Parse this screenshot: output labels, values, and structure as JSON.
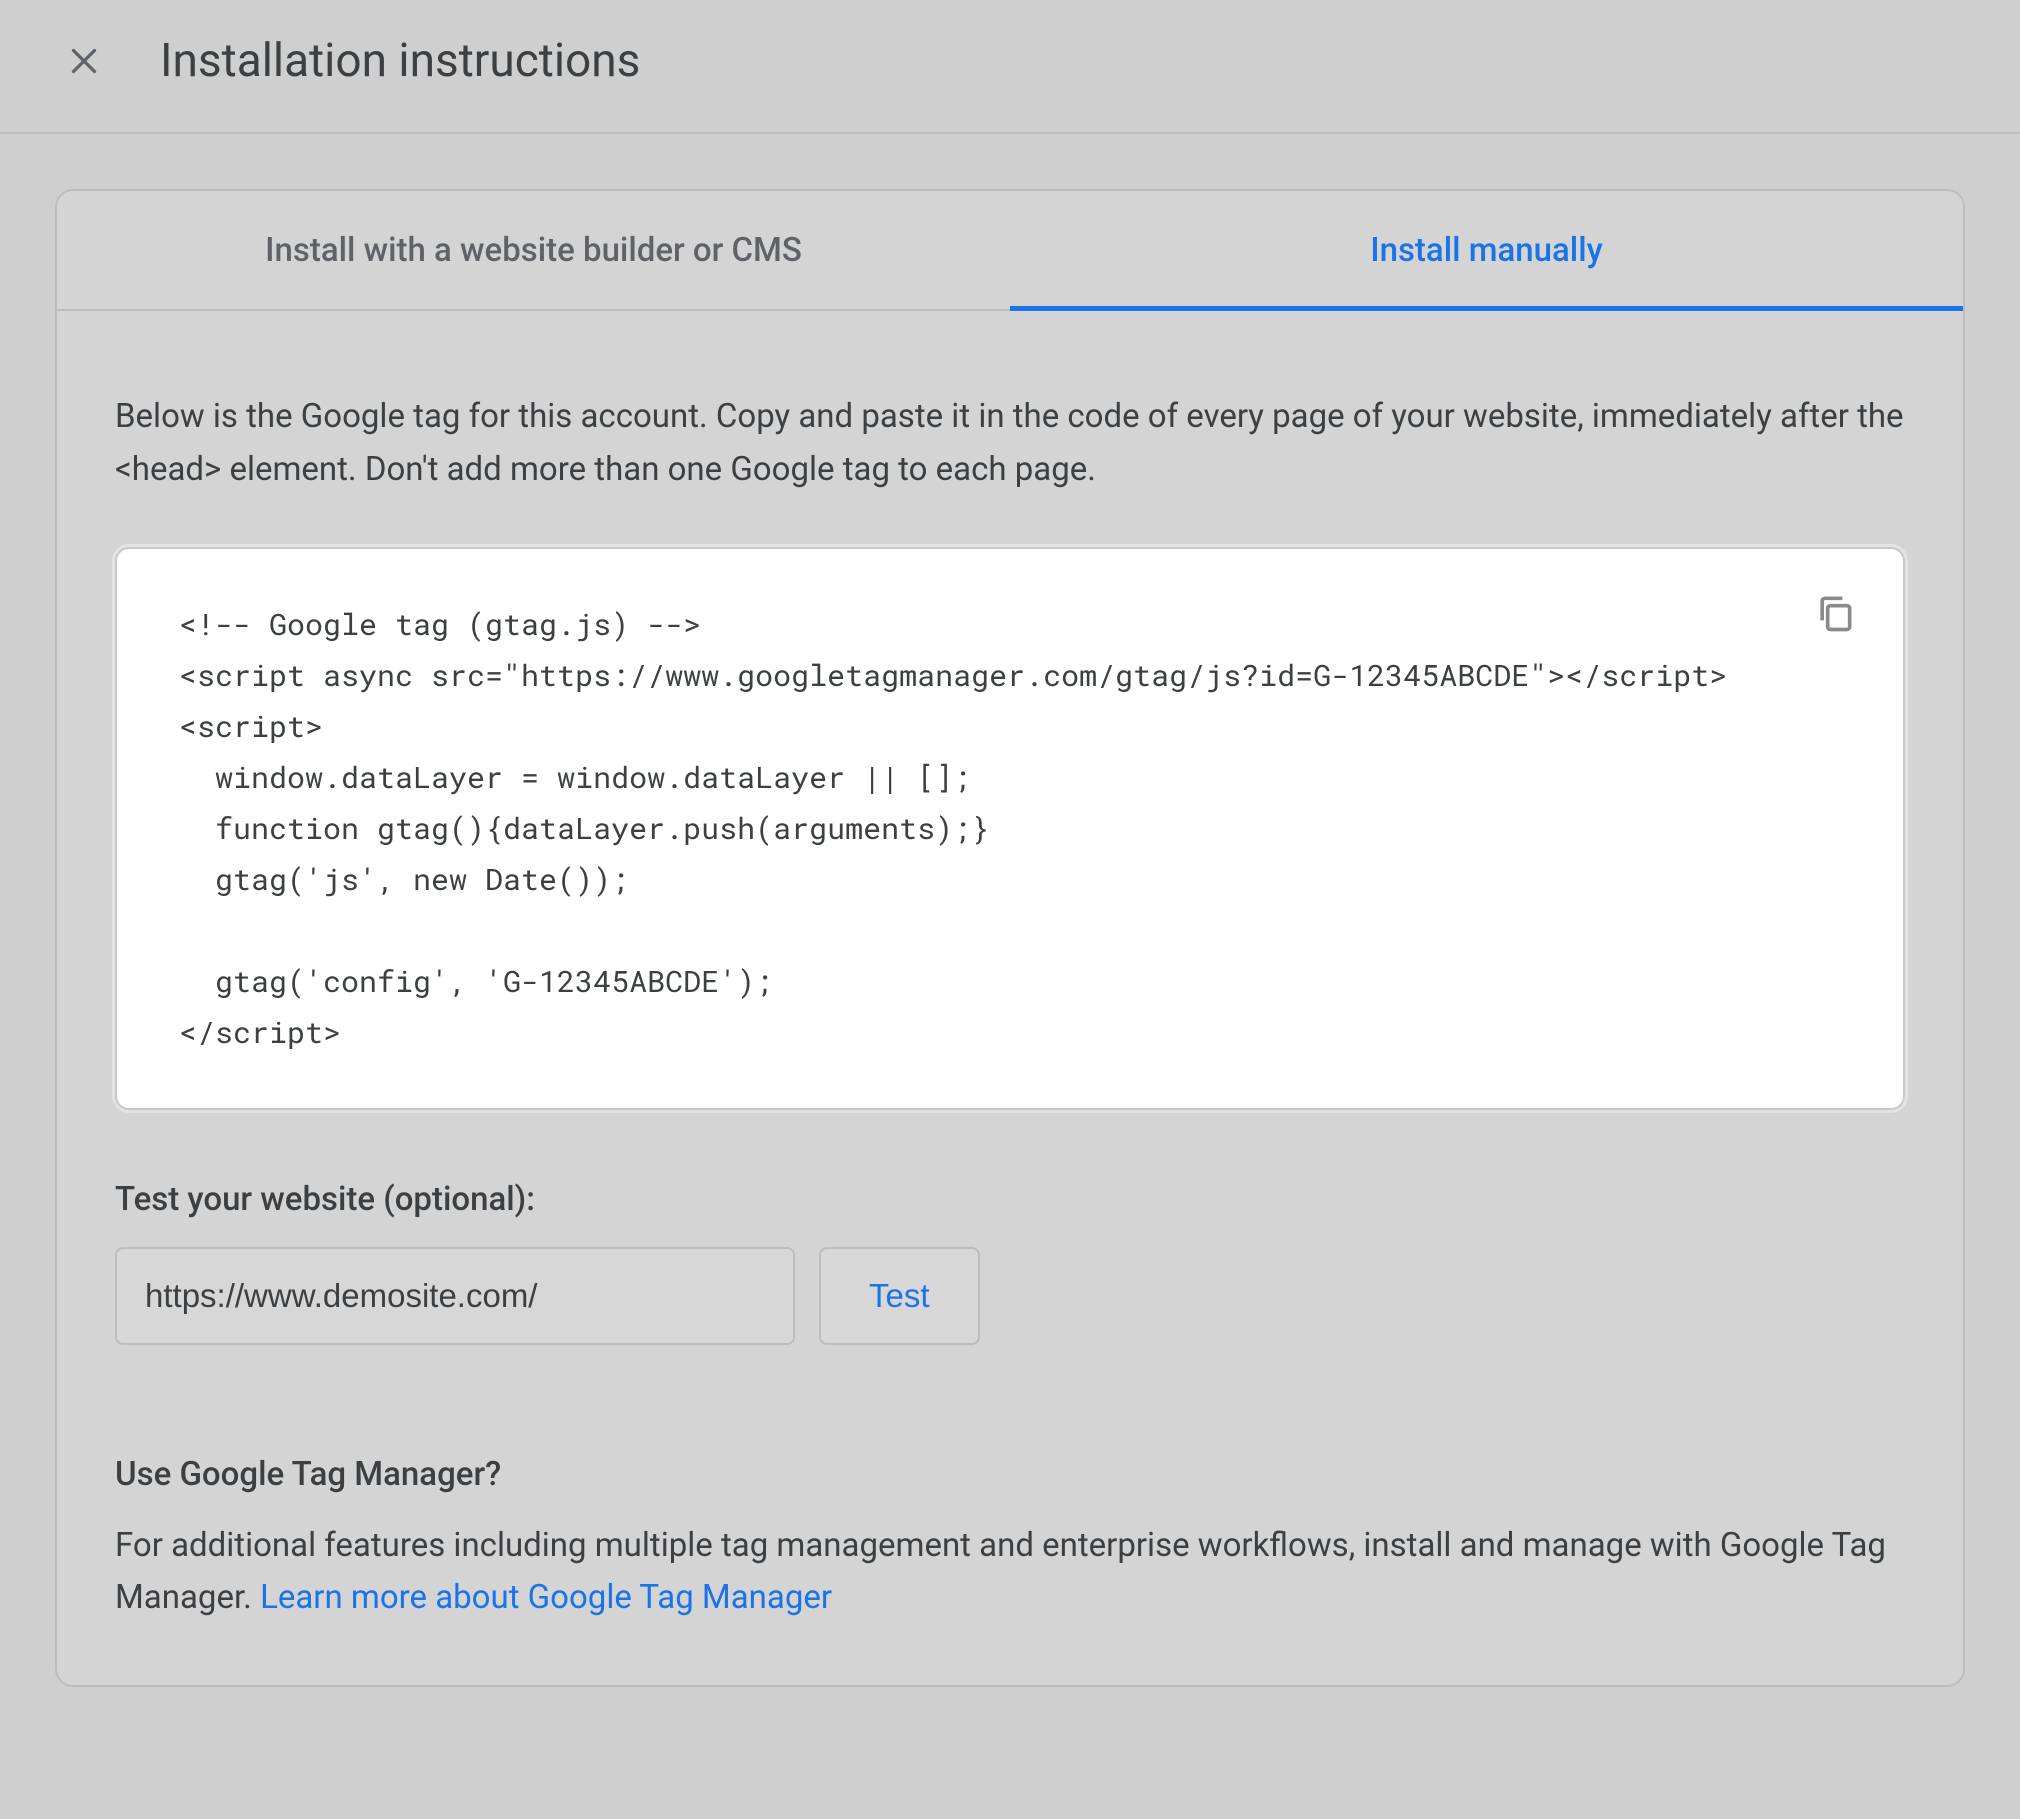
{
  "header": {
    "title": "Installation instructions"
  },
  "tabs": {
    "builder": "Install with a website builder or CMS",
    "manual": "Install manually"
  },
  "main": {
    "description": "Below is the Google tag for this account. Copy and paste it in the code of every page of your website, immediately after the <head> element. Don't add more than one Google tag to each page.",
    "code": "<!-- Google tag (gtag.js) -->\n<script async src=\"https://www.googletagmanager.com/gtag/js?id=G-12345ABCDE\"></script>\n<script>\n  window.dataLayer = window.dataLayer || [];\n  function gtag(){dataLayer.push(arguments);}\n  gtag('js', new Date());\n\n  gtag('config', 'G-12345ABCDE');\n</script>",
    "test_label": "Test your website (optional):",
    "url_value": "https://www.demosite.com/",
    "test_button": "Test",
    "gtm_heading": "Use Google Tag Manager?",
    "gtm_text": "For additional features including multiple tag management and enterprise workflows, install and manage with Google Tag Manager. ",
    "gtm_link": "Learn more about Google Tag Manager"
  }
}
